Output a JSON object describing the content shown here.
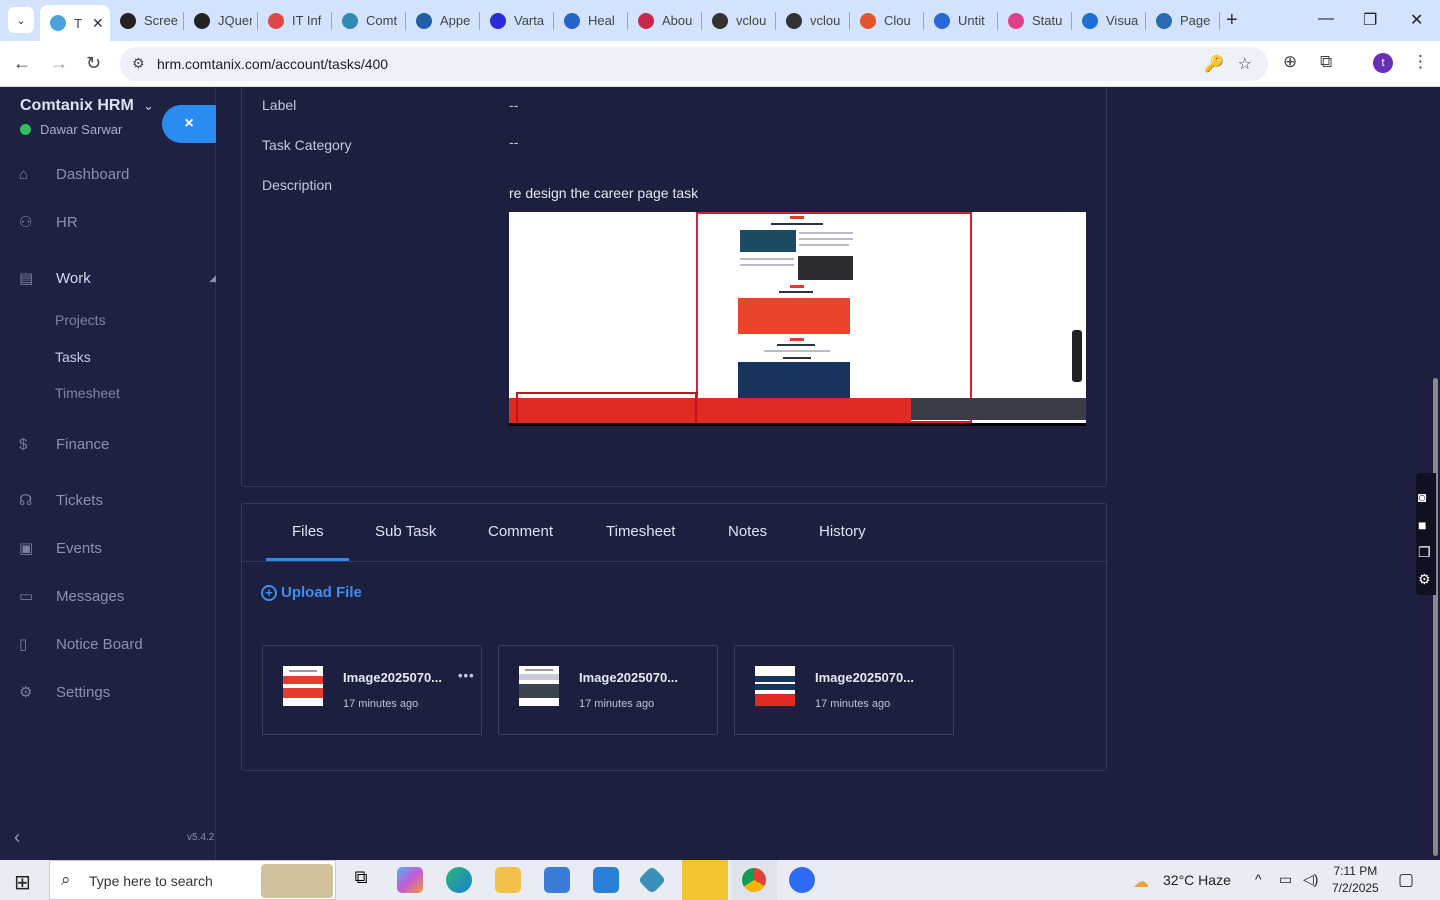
{
  "browser": {
    "tabs": [
      {
        "label": "T",
        "color": "#4aa3df",
        "active": true
      },
      {
        "label": "Screen",
        "color": "#222222"
      },
      {
        "label": "JQuery",
        "color": "#222222"
      },
      {
        "label": "IT Inf",
        "color": "#e04848"
      },
      {
        "label": "Comt",
        "color": "#2f8ab8"
      },
      {
        "label": "Appe",
        "color": "#1f5fa8"
      },
      {
        "label": "Varta",
        "color": "#2b2bd8"
      },
      {
        "label": "Heal",
        "color": "#2463c9"
      },
      {
        "label": "Abou",
        "color": "#c8284f"
      },
      {
        "label": "vclou",
        "color": "#333333"
      },
      {
        "label": "vclou",
        "color": "#333333"
      },
      {
        "label": "Clou",
        "color": "#e2542c"
      },
      {
        "label": "Untit",
        "color": "#2a67d8"
      },
      {
        "label": "Statu",
        "color": "#e0408a"
      },
      {
        "label": "Visua",
        "color": "#1f6fd8"
      },
      {
        "label": "Page",
        "color": "#2b6cb0"
      }
    ],
    "url": "hrm.comtanix.com/account/tasks/400",
    "profile_initial": "t"
  },
  "sidebar": {
    "brand": "Comtanix HRM",
    "user": "Dawar Sarwar",
    "close_label": "×",
    "items": [
      {
        "label": "Dashboard",
        "icon": "⌂"
      },
      {
        "label": "HR",
        "icon": "⚇"
      },
      {
        "label": "Work",
        "icon": "▤"
      },
      {
        "label": "Finance",
        "icon": "$"
      },
      {
        "label": "Tickets",
        "icon": "☊"
      },
      {
        "label": "Events",
        "icon": "▣"
      },
      {
        "label": "Messages",
        "icon": "▭"
      },
      {
        "label": "Notice Board",
        "icon": "▯"
      },
      {
        "label": "Settings",
        "icon": "⚙"
      }
    ],
    "work_sub": [
      "Projects",
      "Tasks",
      "Timesheet"
    ],
    "version": "v5.4.2"
  },
  "task": {
    "label_title": "Label",
    "label_value": "--",
    "category_title": "Task Category",
    "category_value": "--",
    "description_title": "Description",
    "description_text": "re design the career page task"
  },
  "tabs": [
    "Files",
    "Sub Task",
    "Comment",
    "Timesheet",
    "Notes",
    "History"
  ],
  "active_tab": "Files",
  "upload_label": "Upload File",
  "files": [
    {
      "name": "Image2025070...",
      "time": "17 minutes ago"
    },
    {
      "name": "Image2025070...",
      "time": "17 minutes ago"
    },
    {
      "name": "Image2025070...",
      "time": "17 minutes ago"
    }
  ],
  "taskbar": {
    "search_placeholder": "Type here to search",
    "weather": "32°C  Haze",
    "time": "7:11 PM",
    "date": "7/2/2025"
  }
}
